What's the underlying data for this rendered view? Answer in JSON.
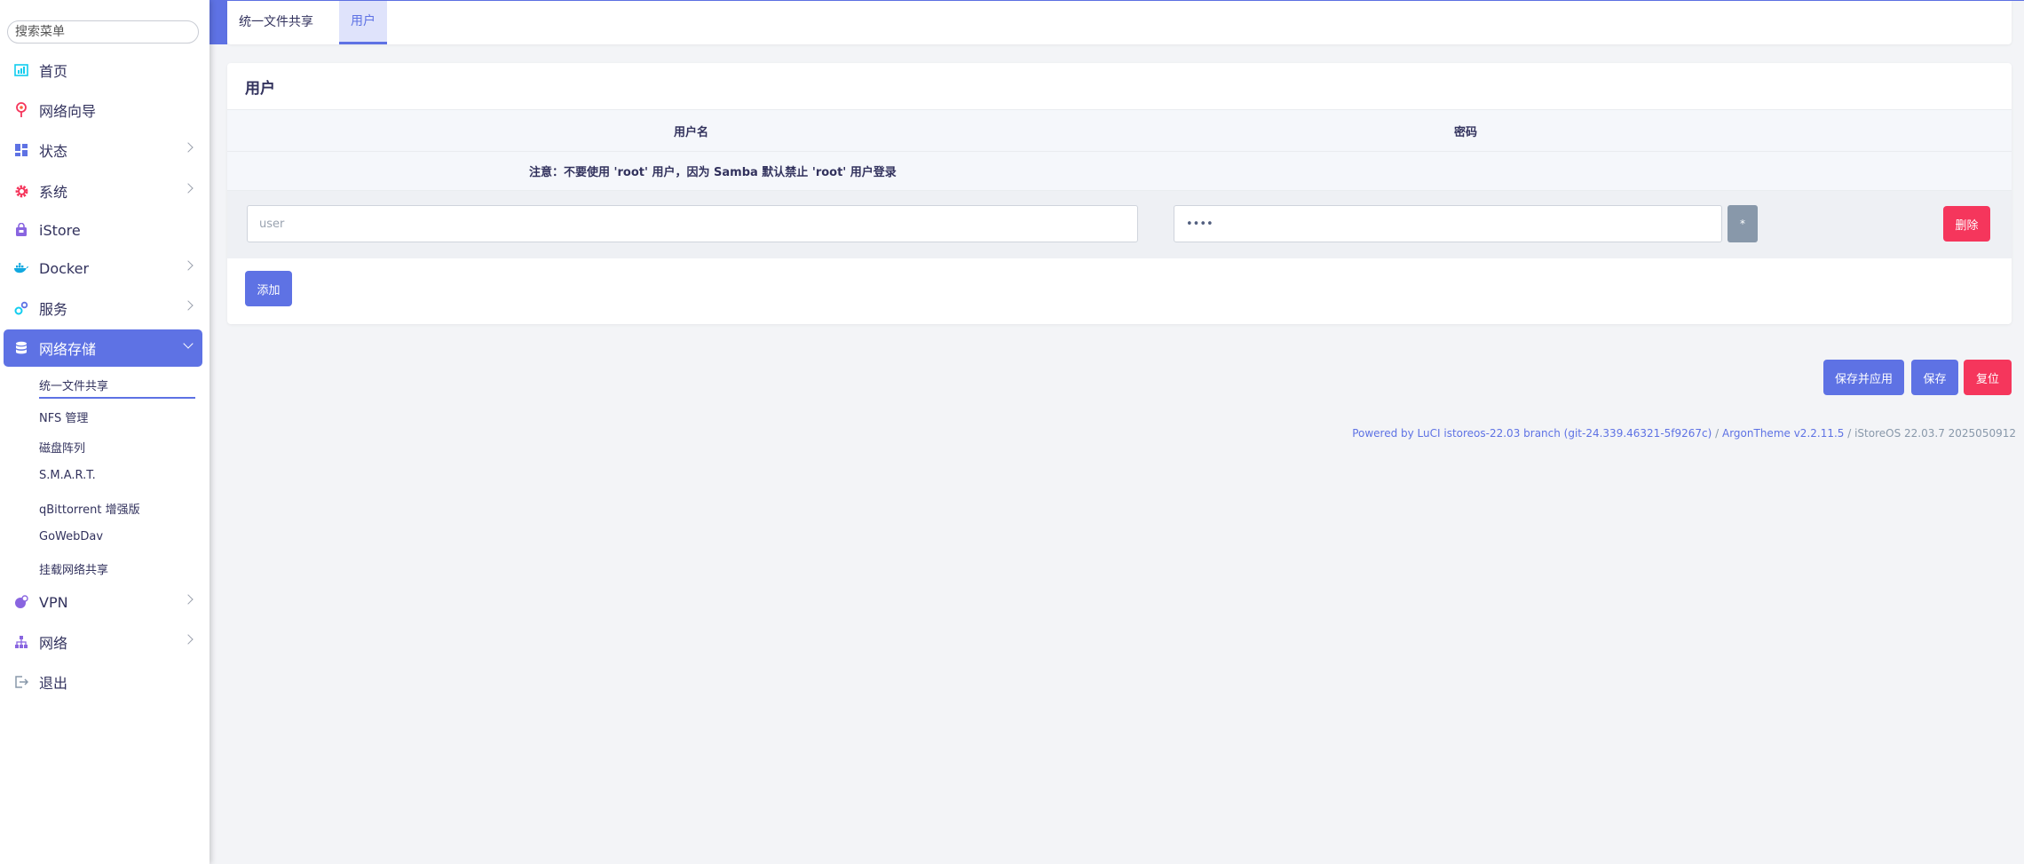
{
  "sidebar": {
    "search_placeholder": "搜索菜单",
    "items": [
      {
        "label": "首页",
        "icon": "dashboard-icon",
        "color": "#11cdef"
      },
      {
        "label": "网络向导",
        "icon": "location-pin-icon",
        "color": "#f5365c"
      },
      {
        "label": "状态",
        "icon": "grid-icon",
        "color": "#5e72e4"
      },
      {
        "label": "系统",
        "icon": "gear-icon",
        "color": "#f5365c"
      },
      {
        "label": "iStore",
        "icon": "store-bag-icon",
        "color": "#8965e0"
      },
      {
        "label": "Docker",
        "icon": "docker-whale-icon",
        "color": "#11a8e0"
      },
      {
        "label": "服务",
        "icon": "services-gears-icon",
        "color": "#11cdef"
      },
      {
        "label": "网络存储",
        "icon": "database-icon",
        "color": "#ffffff"
      },
      {
        "label": "VPN",
        "icon": "vpn-globe-icon",
        "color": "#8965e0"
      },
      {
        "label": "网络",
        "icon": "network-tree-icon",
        "color": "#8965e0"
      },
      {
        "label": "退出",
        "icon": "logout-icon",
        "color": "#8898aa"
      }
    ],
    "submenu": [
      "统一文件共享",
      "NFS 管理",
      "磁盘阵列",
      "S.M.A.R.T.",
      "qBittorrent 增强版",
      "GoWebDav",
      "挂载网络共享"
    ]
  },
  "tabs": [
    "统一文件共享",
    "用户"
  ],
  "panel": {
    "title": "用户",
    "col_username": "用户名",
    "col_password": "密码",
    "note": "注意：不要使用 'root' 用户，因为 Samba 默认禁止 'root' 用户登录",
    "username_placeholder": "user",
    "password_value": "••••",
    "eye_glyph": "*",
    "delete_label": "删除",
    "add_label": "添加"
  },
  "actions": {
    "save_apply": "保存并应用",
    "save": "保存",
    "reset": "复位"
  },
  "footer": {
    "powered_link": "Powered by LuCI istoreos-22.03 branch (git-24.339.46321-5f9267c)",
    "sep1": " / ",
    "theme_link": "ArgonTheme v2.2.11.5",
    "sep2": " / ",
    "version": "iStoreOS 22.03.7 2025050912"
  },
  "colors": {
    "accent": "#5e72e4",
    "danger": "#f5365c"
  }
}
